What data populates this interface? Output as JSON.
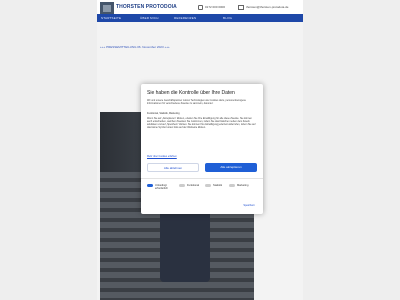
{
  "header": {
    "logo_text": "THORSTEN PROTODOIA",
    "phone": "0172 000 0000",
    "email": "thorsten@thorsten-protodoia.de"
  },
  "nav": {
    "items": [
      "STARTSEITE",
      "ÜBER MICH",
      "REFERENZEN",
      "BLOG"
    ]
  },
  "content": {
    "press_line": "+++ PRESSEMITTEILUNG 06. November 2023 +++"
  },
  "cookie_dialog": {
    "title": "Sie haben die Kontrolle über Ihre Daten",
    "intro": "Wir und unsere Geschäftspartner nutzen Technologien wie Cookies dazu, personenbezogene Informationen für verschiedene Zwecke zu sammeln, darunter:",
    "categories": "Funktional, Statistik, Marketing",
    "details": "Wenn Sie auf „Akzeptieren“ klicken, erteilen Sie Ihre Einwilligung für alle diese Zwecke. Sie können auch entscheiden, welchen Zwecken Sie zustimmen, indem Sie das Kästchen neben dem Zweck anklicken und auf „Speichern“ klicken. Sie können Ihre Einwilligung jederzeit widerrufen, indem Sie auf das kleine Symbol unten links auf der Webseite klicken.",
    "link": "Mehr über Cookies erfahren",
    "reject_label": "Alle ablehnen",
    "accept_label": "Alle akzeptieren",
    "checkboxes": [
      {
        "label": "Unbedingt erforderlich",
        "on": true
      },
      {
        "label": "Funktional",
        "on": false
      },
      {
        "label": "Statistik",
        "on": false
      },
      {
        "label": "Marketing",
        "on": false
      }
    ],
    "save_label": "Speichern"
  }
}
